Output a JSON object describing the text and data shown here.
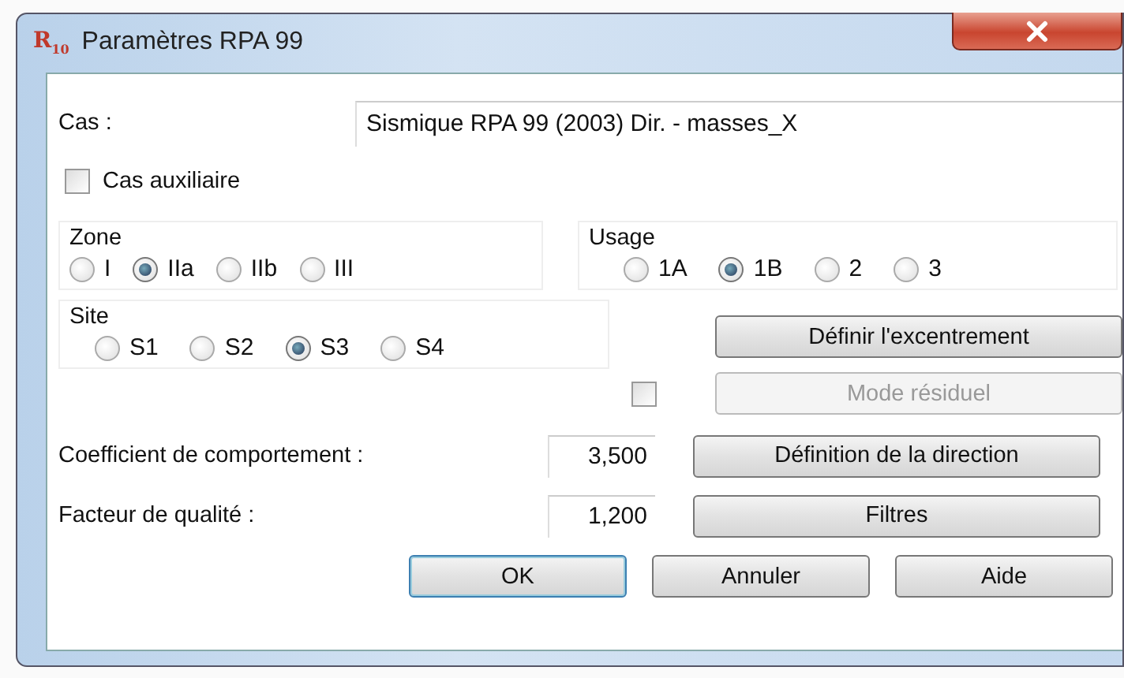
{
  "window": {
    "logo": "R$_{10}$",
    "title": "Paramètres RPA 99"
  },
  "case": {
    "label": "Cas :",
    "value": "Sismique RPA 99 (2003) Dir. - masses_X"
  },
  "auxiliary": {
    "label": "Cas auxiliaire",
    "checked": false
  },
  "groups": [
    {
      "label": "Zone",
      "options": [
        {
          "label": "I",
          "selected": false
        },
        {
          "label": "IIa",
          "selected": true
        },
        {
          "label": "IIb",
          "selected": false
        },
        {
          "label": "III",
          "selected": false
        }
      ]
    },
    {
      "label": "Usage",
      "options": [
        {
          "label": "1A",
          "selected": false
        },
        {
          "label": "1B",
          "selected": true
        },
        {
          "label": "2",
          "selected": false
        },
        {
          "label": "3",
          "selected": false
        }
      ]
    },
    {
      "label": "Site",
      "options": [
        {
          "label": "S1",
          "selected": false
        },
        {
          "label": "S2",
          "selected": false
        },
        {
          "label": "S3",
          "selected": true
        },
        {
          "label": "S4",
          "selected": false
        }
      ]
    }
  ],
  "eccentricity_button": "Définir l'excentrement",
  "residual": {
    "checked": false,
    "label": "Mode résiduel",
    "disabled": true
  },
  "behaviour": {
    "label": "Coefficient de comportement :",
    "value": "3,500",
    "button": "Définition de la direction"
  },
  "quality": {
    "label": "Facteur de qualité :",
    "value": "1,200",
    "button": "Filtres"
  },
  "buttons": [
    {
      "label": "OK",
      "default": true
    },
    {
      "label": "Annuler",
      "default": false
    },
    {
      "label": "Aide",
      "default": false
    }
  ]
}
